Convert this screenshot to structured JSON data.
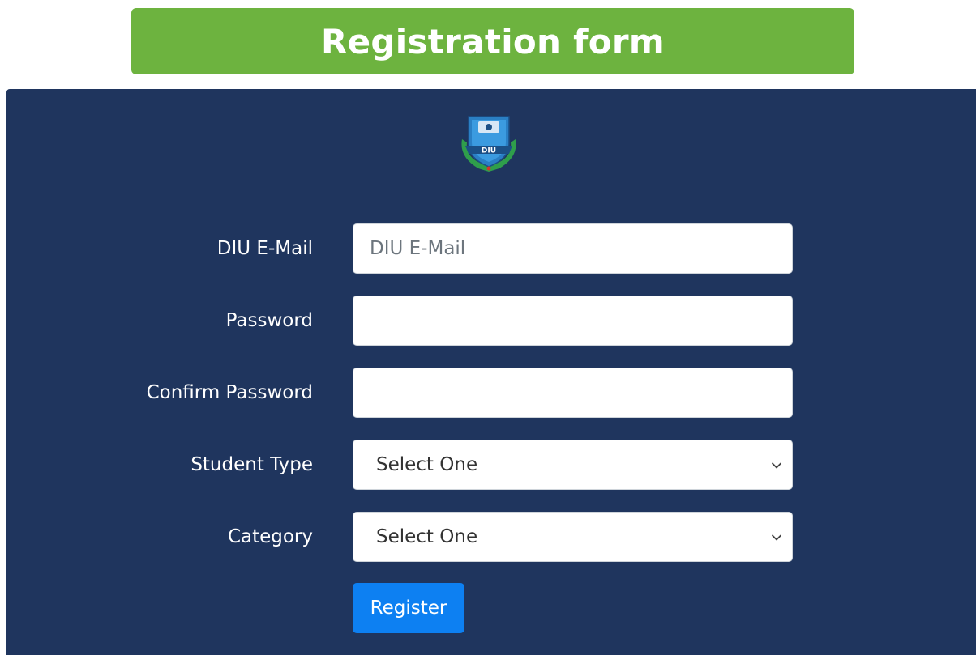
{
  "header": {
    "title": "Registration form"
  },
  "logo": {
    "text": "DIU"
  },
  "form": {
    "email": {
      "label": "DIU E-Mail",
      "placeholder": "DIU E-Mail",
      "value": ""
    },
    "password": {
      "label": "Password",
      "value": ""
    },
    "confirm_password": {
      "label": "Confirm Password",
      "value": ""
    },
    "student_type": {
      "label": "Student Type",
      "selected": "Select One"
    },
    "category": {
      "label": "Category",
      "selected": "Select One"
    },
    "submit_label": "Register"
  },
  "colors": {
    "header_bg": "#6db33f",
    "panel_bg": "#1f355e",
    "button_bg": "#0d80f2"
  },
  "icons": [
    "diu-logo-icon",
    "chevron-down-icon"
  ]
}
